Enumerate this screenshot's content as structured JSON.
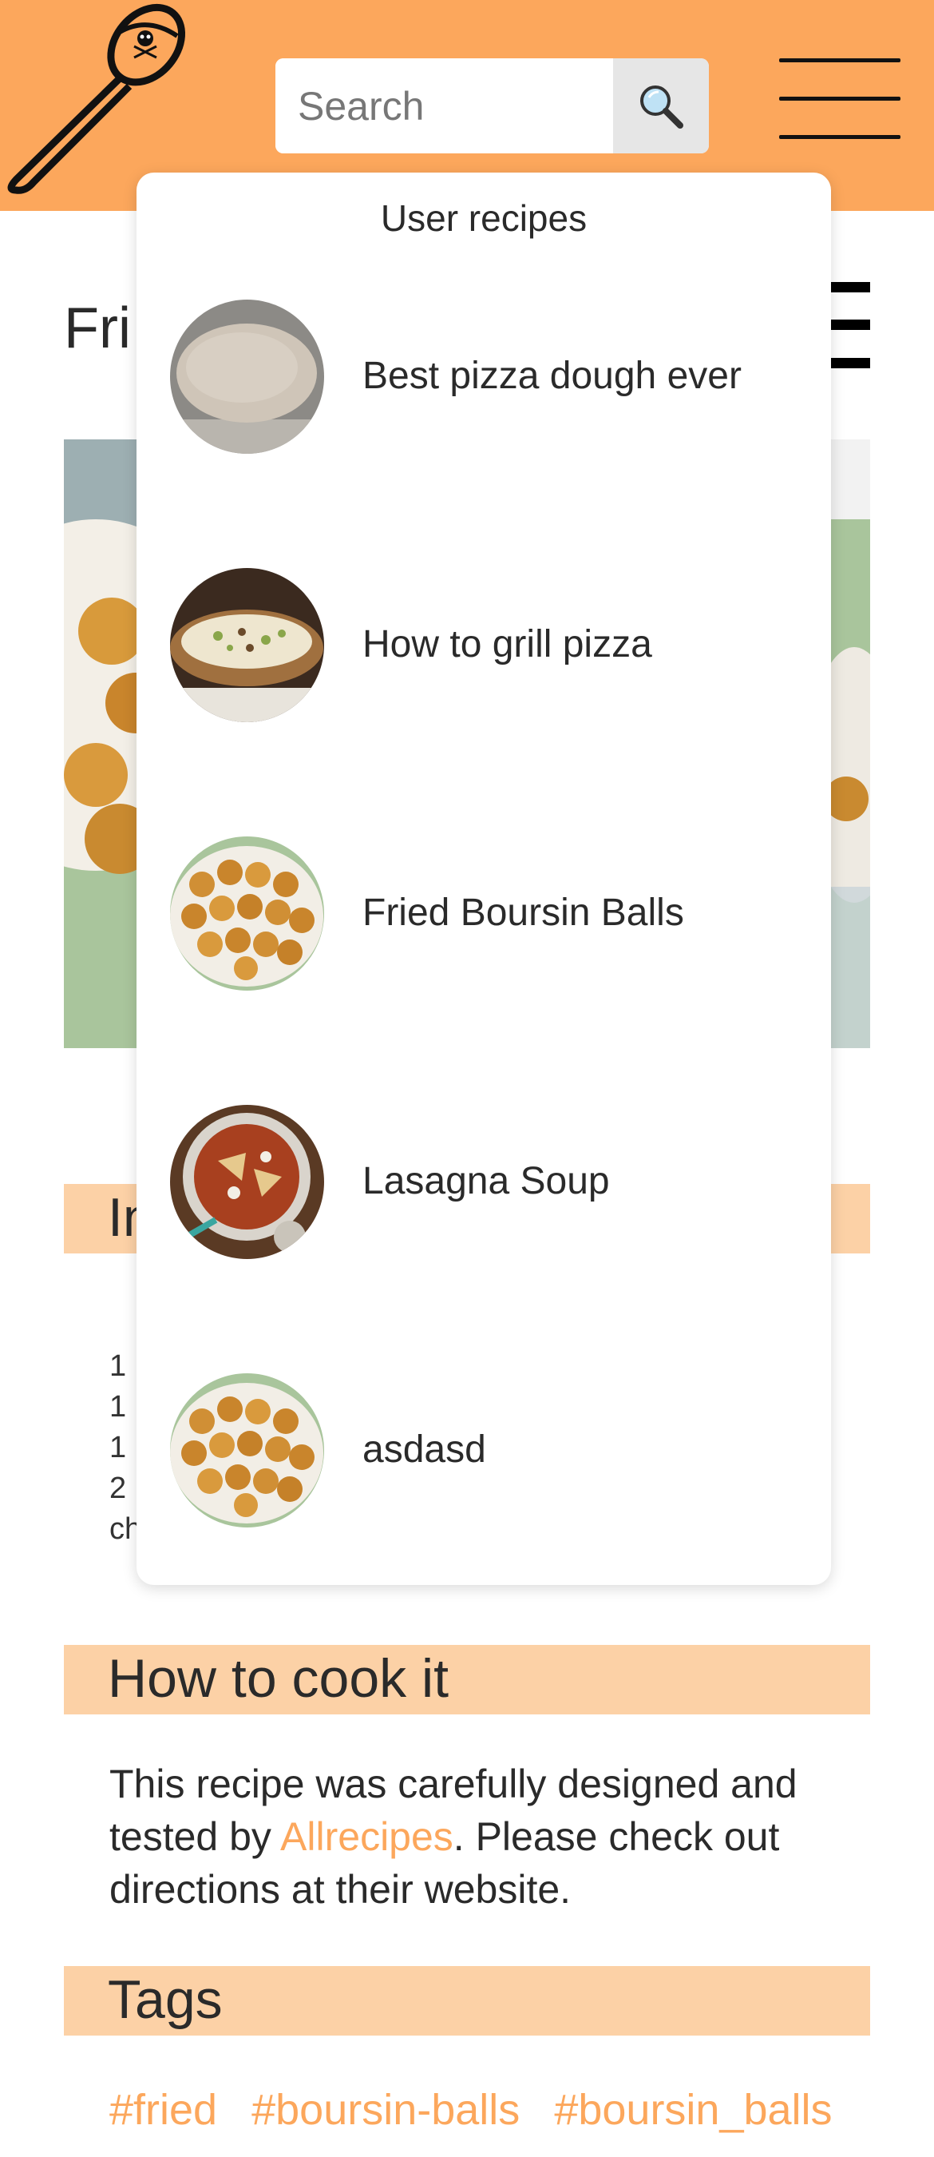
{
  "header": {
    "logo_icon": "pirate-spoon-logo",
    "search": {
      "placeholder": "Search",
      "value": ""
    },
    "search_icon": "magnifier-icon",
    "menu_icon": "hamburger-icon"
  },
  "page": {
    "title_visible": "Fri",
    "list_icon": "list-icon",
    "sections": {
      "ingredients_visible": "In",
      "cook": "How to cook it",
      "tags": "Tags"
    },
    "ingredients_visible": [
      "1",
      "1",
      "1",
      "2",
      "ch"
    ],
    "cook_text": {
      "before": "This recipe was carefully designed and tested by ",
      "link": "Allrecipes",
      "after": ". Please check out directions at their website."
    },
    "tags": [
      "#fried",
      "#boursin-balls",
      "#boursin_balls"
    ]
  },
  "dropdown": {
    "title": "User recipes",
    "results": [
      {
        "label": "Best pizza dough ever",
        "thumb": "pizza-dough-photo"
      },
      {
        "label": "How to grill pizza",
        "thumb": "grilled-pizza-photo"
      },
      {
        "label": "Fried Boursin Balls",
        "thumb": "boursin-balls-photo"
      },
      {
        "label": "Lasagna Soup",
        "thumb": "lasagna-soup-photo"
      },
      {
        "label": "asdasd",
        "thumb": "boursin-balls-photo"
      }
    ]
  },
  "colors": {
    "accent": "#fca75c",
    "section_bg": "#fcd1a6",
    "text": "#2a2a2a"
  }
}
